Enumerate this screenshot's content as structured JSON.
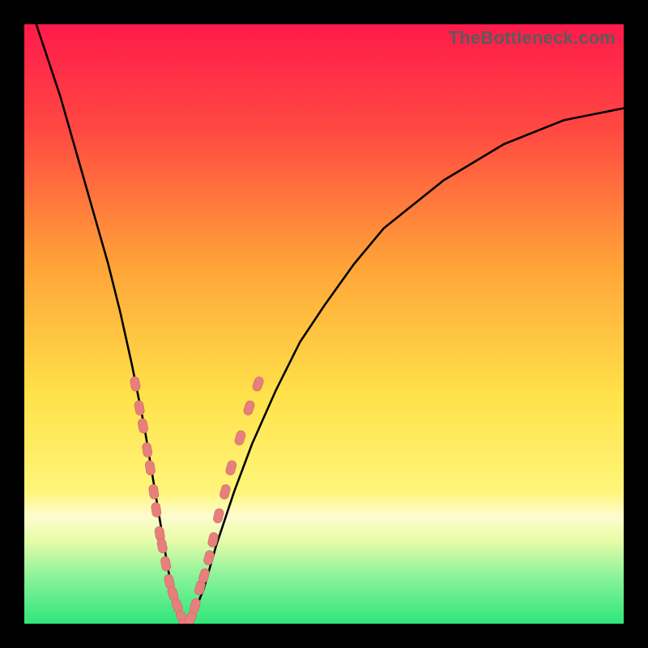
{
  "watermark": "TheBottleneck.com",
  "colors": {
    "frame": "#000000",
    "curve": "#000000",
    "markerFill": "#e77f7c",
    "markerStroke": "#cf6965",
    "greenBand": "#2fe67a"
  },
  "chart_data": {
    "type": "line",
    "title": "",
    "xlabel": "",
    "ylabel": "",
    "xlim": [
      0,
      100
    ],
    "ylim": [
      0,
      100
    ],
    "gradient_stops": [
      {
        "pct": 0,
        "color": "#ff1a4b"
      },
      {
        "pct": 18,
        "color": "#ff4a41"
      },
      {
        "pct": 40,
        "color": "#ffa338"
      },
      {
        "pct": 62,
        "color": "#ffe24a"
      },
      {
        "pct": 78,
        "color": "#fff57a"
      },
      {
        "pct": 82,
        "color": "#fdfccf"
      },
      {
        "pct": 86,
        "color": "#e9fca8"
      },
      {
        "pct": 92,
        "color": "#8cf39a"
      },
      {
        "pct": 100,
        "color": "#2fe67a"
      }
    ],
    "series": [
      {
        "name": "bottleneck-curve",
        "x": [
          0,
          2,
          4,
          6,
          8,
          10,
          12,
          14,
          16,
          18,
          20,
          21,
          22,
          23,
          24,
          25,
          26,
          27,
          28,
          30,
          32,
          35,
          38,
          42,
          46,
          50,
          55,
          60,
          65,
          70,
          75,
          80,
          85,
          90,
          95,
          100
        ],
        "y": [
          106,
          100,
          94,
          88,
          81,
          74,
          67,
          60,
          52,
          43,
          33,
          27,
          21,
          15,
          9,
          4,
          1,
          0,
          1,
          6,
          13,
          22,
          30,
          39,
          47,
          53,
          60,
          66,
          70,
          74,
          77,
          80,
          82,
          84,
          85,
          86
        ]
      }
    ],
    "markers": [
      {
        "x": 18.5,
        "y": 40
      },
      {
        "x": 19.2,
        "y": 36
      },
      {
        "x": 19.8,
        "y": 33
      },
      {
        "x": 20.5,
        "y": 29
      },
      {
        "x": 21.0,
        "y": 26
      },
      {
        "x": 21.6,
        "y": 22
      },
      {
        "x": 22.0,
        "y": 19
      },
      {
        "x": 22.6,
        "y": 15
      },
      {
        "x": 23.0,
        "y": 13
      },
      {
        "x": 23.6,
        "y": 10
      },
      {
        "x": 24.2,
        "y": 7
      },
      {
        "x": 24.8,
        "y": 5
      },
      {
        "x": 25.5,
        "y": 3
      },
      {
        "x": 26.3,
        "y": 1
      },
      {
        "x": 27.0,
        "y": 0
      },
      {
        "x": 27.8,
        "y": 1
      },
      {
        "x": 28.5,
        "y": 3
      },
      {
        "x": 29.3,
        "y": 6
      },
      {
        "x": 30.0,
        "y": 8
      },
      {
        "x": 30.8,
        "y": 11
      },
      {
        "x": 31.5,
        "y": 14
      },
      {
        "x": 32.4,
        "y": 18
      },
      {
        "x": 33.5,
        "y": 22
      },
      {
        "x": 34.5,
        "y": 26
      },
      {
        "x": 36.0,
        "y": 31
      },
      {
        "x": 37.5,
        "y": 36
      },
      {
        "x": 39.0,
        "y": 40
      }
    ]
  }
}
